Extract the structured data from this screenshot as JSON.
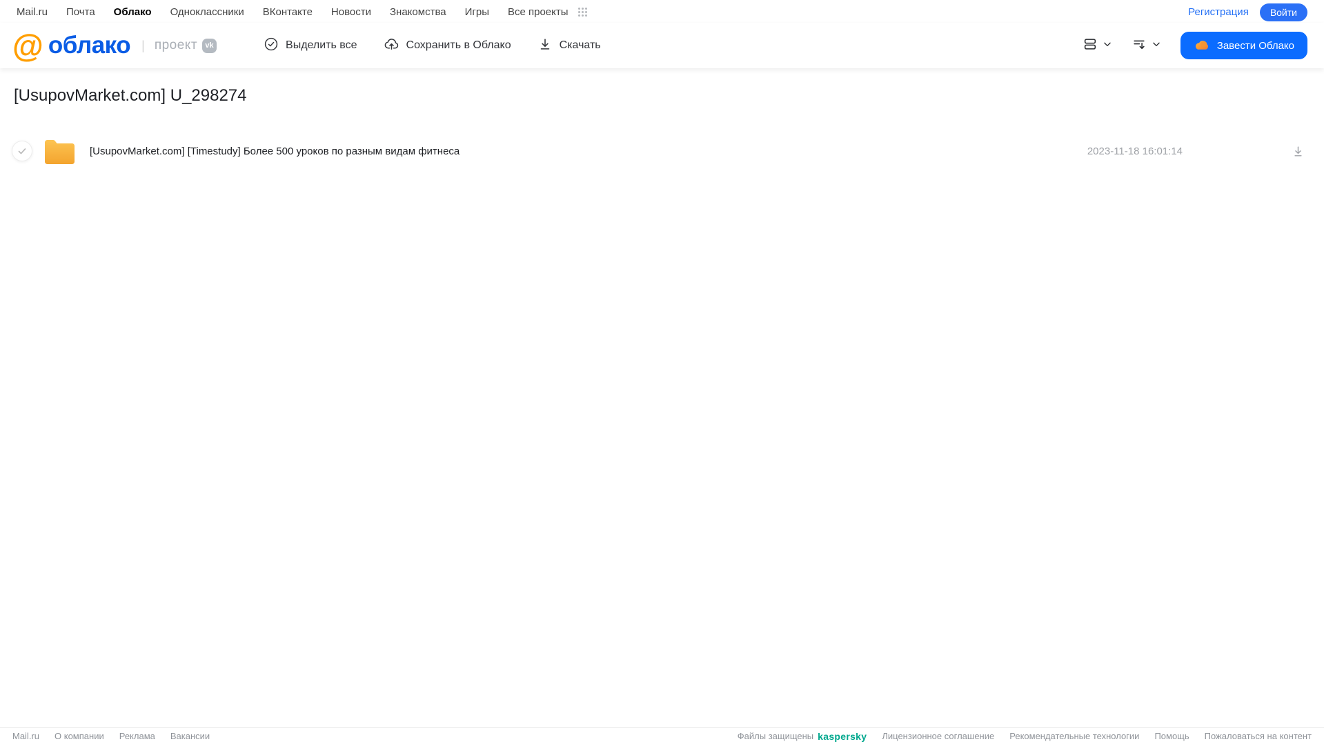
{
  "topnav": {
    "items": [
      {
        "label": "Mail.ru",
        "active": false
      },
      {
        "label": "Почта",
        "active": false
      },
      {
        "label": "Облако",
        "active": true
      },
      {
        "label": "Одноклассники",
        "active": false
      },
      {
        "label": "ВКонтакте",
        "active": false
      },
      {
        "label": "Новости",
        "active": false
      },
      {
        "label": "Знакомства",
        "active": false
      },
      {
        "label": "Игры",
        "active": false
      },
      {
        "label": "Все проекты",
        "active": false
      }
    ],
    "registration_label": "Регистрация",
    "login_label": "Войти"
  },
  "header": {
    "logo_at": "@",
    "logo_text": "облако",
    "divider": "|",
    "project_label": "проект",
    "vk_badge": "vk",
    "toolbar": {
      "select_all": "Выделить все",
      "save_to_cloud": "Сохранить в Облако",
      "download": "Скачать"
    },
    "get_cloud_button": "Завести Облако"
  },
  "main": {
    "title": "[UsupovMarket.com] U_298274",
    "files": [
      {
        "type": "folder",
        "name": "[UsupovMarket.com] [Timestudy] Более 500 уроков по разным видам фитнеса",
        "date": "2023-11-18 16:01:14"
      }
    ]
  },
  "footer": {
    "left_links": [
      "Mail.ru",
      "О компании",
      "Реклама",
      "Вакансии"
    ],
    "protected_text": "Файлы защищены",
    "kaspersky_logo": "kaspersky",
    "right_links": [
      "Лицензионное соглашение",
      "Рекомендательные технологии",
      "Помощь",
      "Пожаловаться на контент"
    ]
  },
  "icons": {
    "all_projects": "grid-dots-icon",
    "select_all": "check-circle-icon",
    "save_to_cloud": "cloud-upload-icon",
    "download": "download-icon",
    "view_mode": "list-view-icon",
    "sort": "sort-icon",
    "get_cloud": "cloud-icon",
    "file": "folder-icon"
  },
  "colors": {
    "brand_blue": "#0b6cff",
    "logo_blue": "#0a5ce5",
    "logo_orange": "#ff9e00",
    "folder_top": "#fdc65c",
    "folder_bottom": "#f4a42c",
    "kaspersky_teal": "#00a88e",
    "muted_gray": "#9ea1a6"
  }
}
